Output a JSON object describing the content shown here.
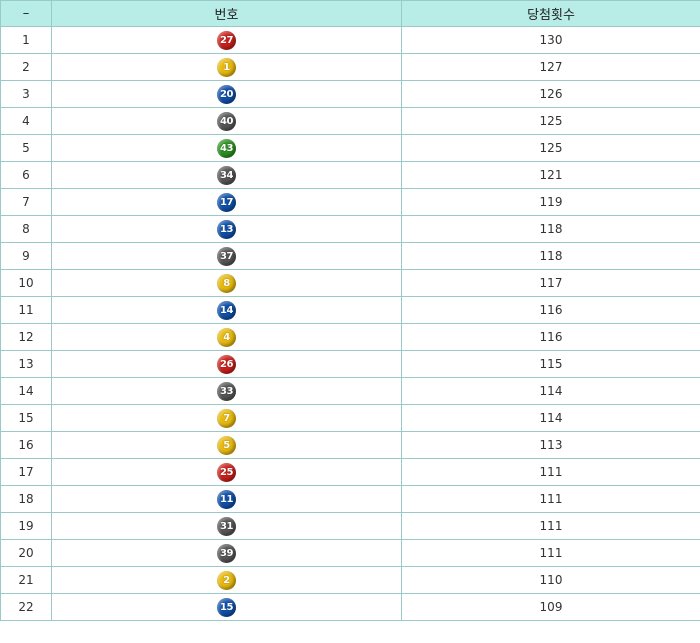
{
  "table": {
    "headers": [
      "–",
      "번호",
      "당첨횟수"
    ],
    "rows": [
      {
        "rank": "1",
        "number": "27",
        "color": "red",
        "count": "130"
      },
      {
        "rank": "2",
        "number": "1",
        "color": "yellow",
        "count": "127"
      },
      {
        "rank": "3",
        "number": "20",
        "color": "blue",
        "count": "126"
      },
      {
        "rank": "4",
        "number": "40",
        "color": "gray",
        "count": "125"
      },
      {
        "rank": "5",
        "number": "43",
        "color": "green",
        "count": "125"
      },
      {
        "rank": "6",
        "number": "34",
        "color": "gray",
        "count": "121"
      },
      {
        "rank": "7",
        "number": "17",
        "color": "blue",
        "count": "119"
      },
      {
        "rank": "8",
        "number": "13",
        "color": "blue",
        "count": "118"
      },
      {
        "rank": "9",
        "number": "37",
        "color": "gray",
        "count": "118"
      },
      {
        "rank": "10",
        "number": "8",
        "color": "yellow",
        "count": "117"
      },
      {
        "rank": "11",
        "number": "14",
        "color": "blue",
        "count": "116"
      },
      {
        "rank": "12",
        "number": "4",
        "color": "yellow",
        "count": "116"
      },
      {
        "rank": "13",
        "number": "26",
        "color": "red",
        "count": "115"
      },
      {
        "rank": "14",
        "number": "33",
        "color": "gray",
        "count": "114"
      },
      {
        "rank": "15",
        "number": "7",
        "color": "yellow",
        "count": "114"
      },
      {
        "rank": "16",
        "number": "5",
        "color": "yellow",
        "count": "113"
      },
      {
        "rank": "17",
        "number": "25",
        "color": "red",
        "count": "111"
      },
      {
        "rank": "18",
        "number": "11",
        "color": "blue",
        "count": "111"
      },
      {
        "rank": "19",
        "number": "31",
        "color": "gray",
        "count": "111"
      },
      {
        "rank": "20",
        "number": "39",
        "color": "gray",
        "count": "111"
      },
      {
        "rank": "21",
        "number": "2",
        "color": "yellow",
        "count": "110"
      },
      {
        "rank": "22",
        "number": "15",
        "color": "blue",
        "count": "109"
      }
    ]
  },
  "ball_colors": {
    "red": "#c9201b",
    "yellow": "#e6b80f",
    "blue": "#0f4fa8",
    "gray": "#555555",
    "green": "#2a8f1f"
  }
}
